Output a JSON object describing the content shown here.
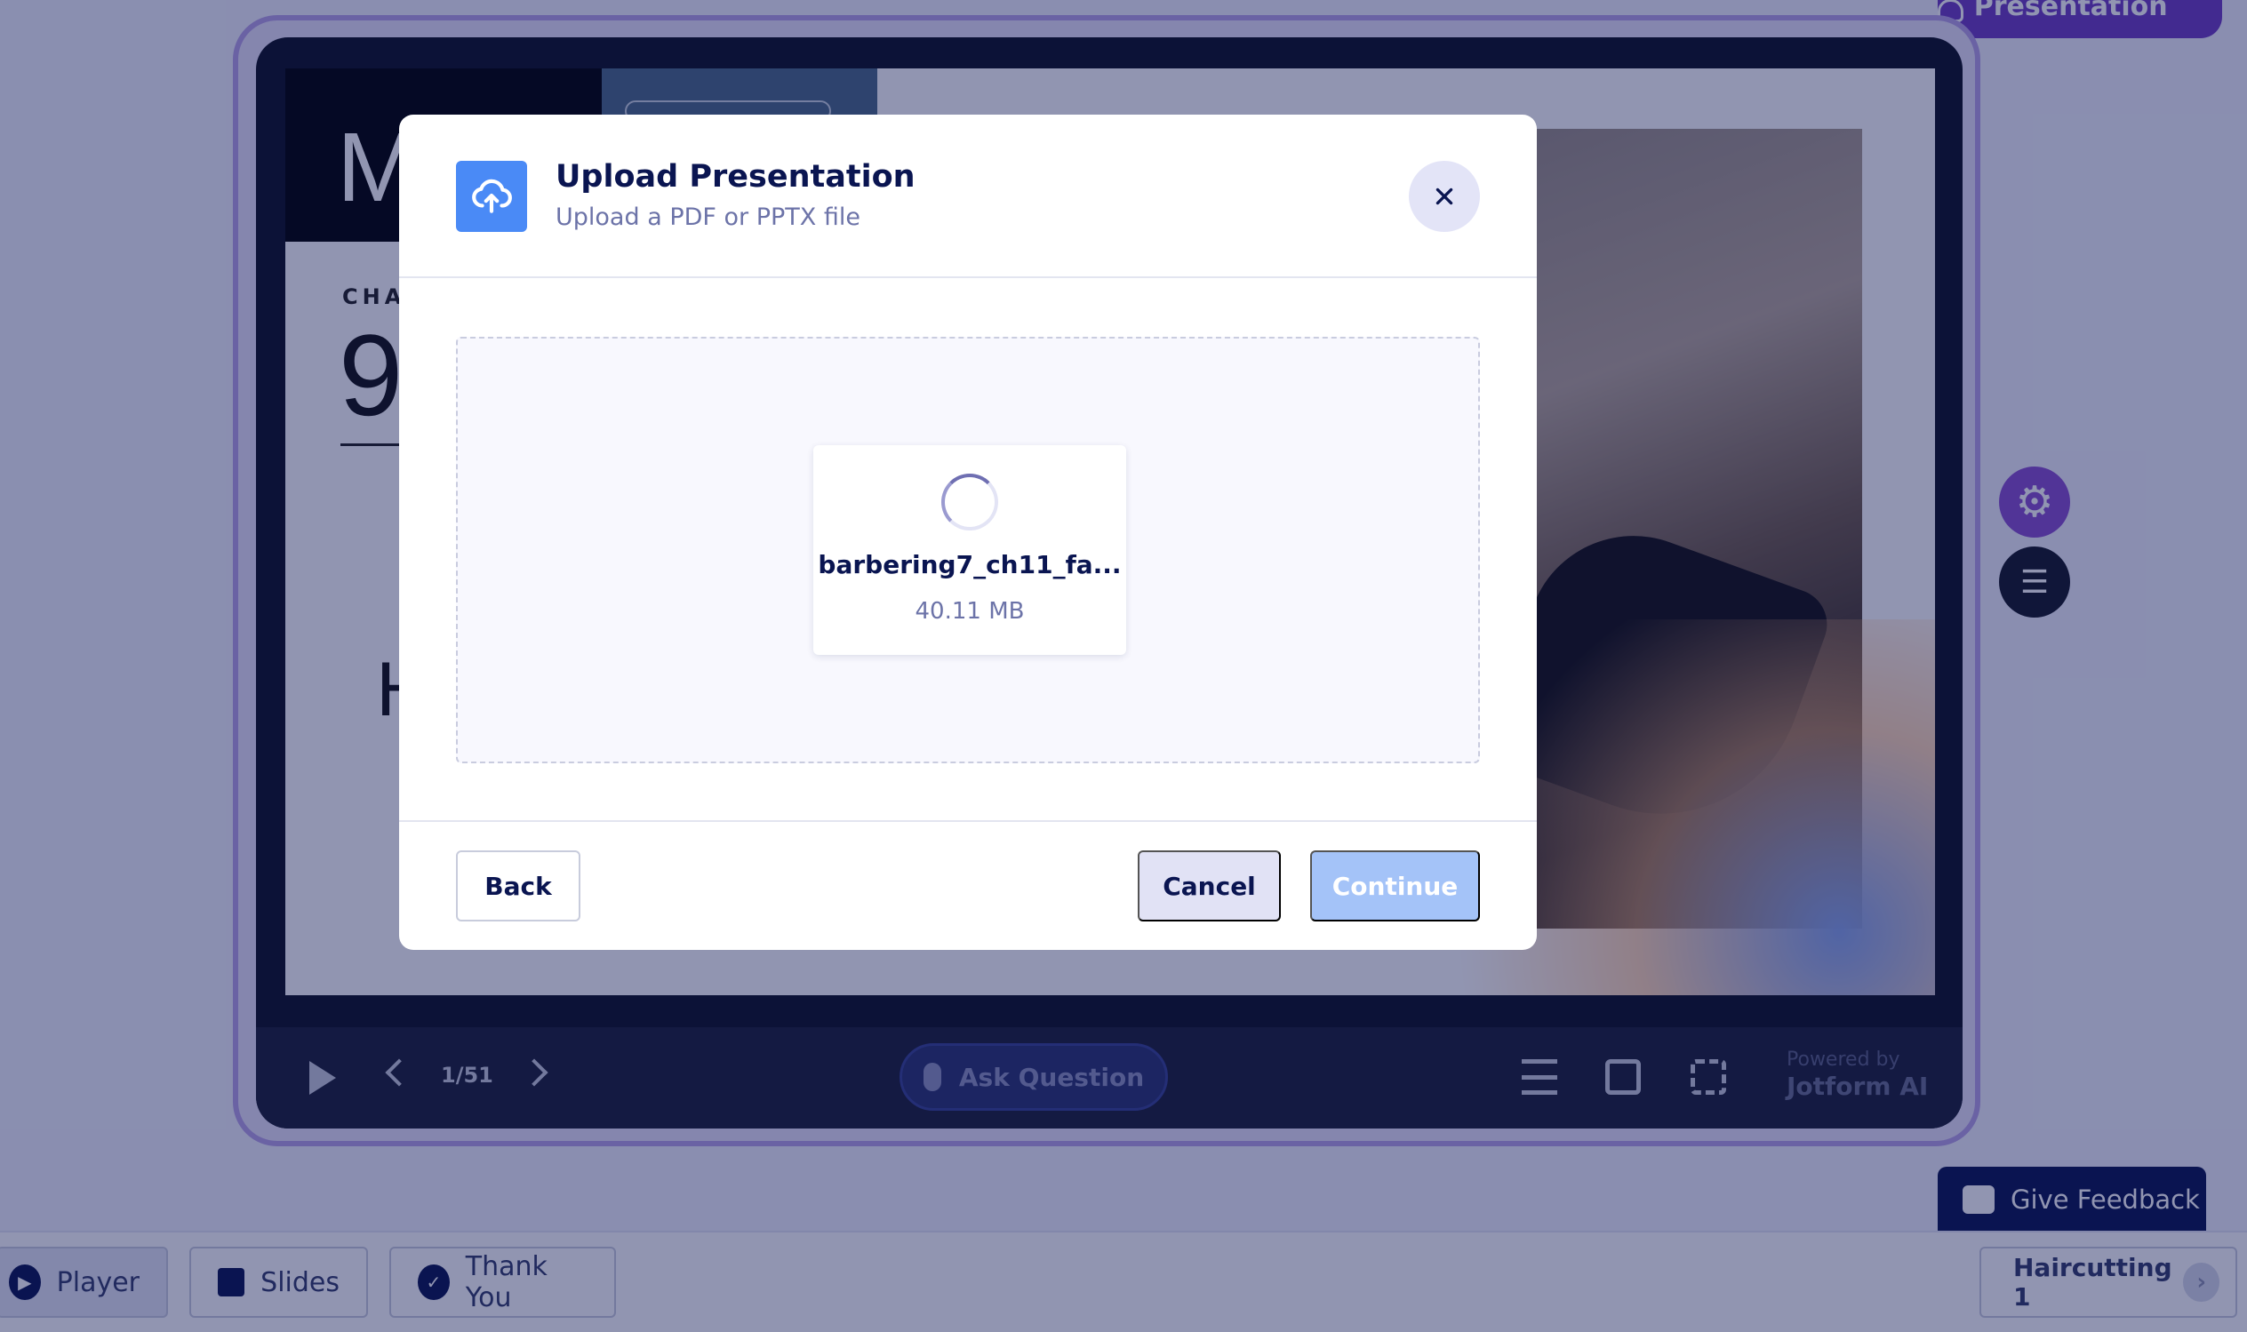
{
  "header": {
    "add_presentation_label": "Add Presentation"
  },
  "slide": {
    "letter_m": "M",
    "chapter_label": "CHA",
    "chapter_number": "9",
    "letter_h": "H"
  },
  "player_controls": {
    "page_indicator": "1/51",
    "ask_question_label": "Ask Question",
    "powered_by_label": "Powered by",
    "powered_by_brand": "Jotform AI"
  },
  "side_buttons": {
    "settings_icon": "gear-icon",
    "list_icon": "list-icon"
  },
  "feedback": {
    "label": "Give Feedback"
  },
  "bottom_tabs": [
    {
      "label": "Player",
      "icon": "play-icon"
    },
    {
      "label": "Slides",
      "icon": "image-icon"
    },
    {
      "label": "Thank You",
      "icon": "check-icon"
    }
  ],
  "agent_selector": {
    "label": "Haircutting 1"
  },
  "modal": {
    "title": "Upload Presentation",
    "subtitle": "Upload a PDF or PPTX file",
    "file": {
      "name": "barbering7_ch11_fa...",
      "size": "40.11 MB"
    },
    "back_label": "Back",
    "cancel_label": "Cancel",
    "continue_label": "Continue"
  },
  "colors": {
    "accent": "#4a8af6",
    "brand_navy": "#0a1551",
    "purple": "#6f3dc4",
    "continue_disabled": "#a4c3f8"
  }
}
